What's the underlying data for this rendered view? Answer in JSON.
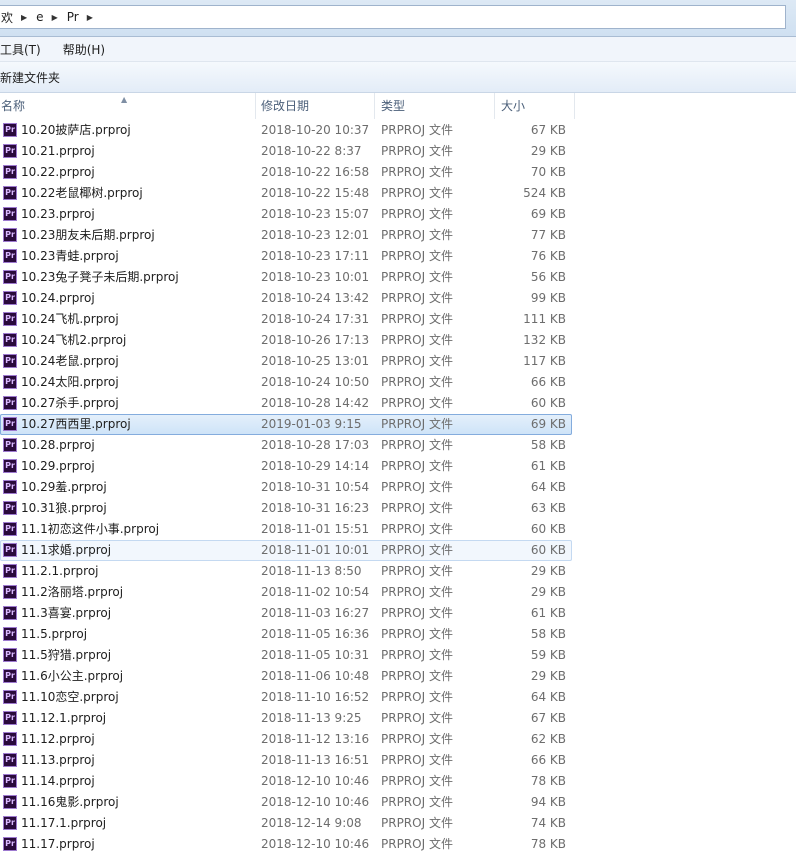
{
  "address": {
    "crumbs": [
      "欢",
      "e",
      "Pr"
    ]
  },
  "menu": {
    "items": [
      "工具(T)",
      "帮助(H)"
    ]
  },
  "toolbar": {
    "new_folder": "新建文件夹"
  },
  "columns": {
    "name": "名称",
    "date": "修改日期",
    "type": "类型",
    "size": "大小"
  },
  "icon": {
    "label": "Pr",
    "name": "premiere-project-icon"
  },
  "files": [
    {
      "name": "10.20披萨店.prproj",
      "date": "2018-10-20 10:37",
      "type": "PRPROJ 文件",
      "size": "67 KB"
    },
    {
      "name": "10.21.prproj",
      "date": "2018-10-22 8:37",
      "type": "PRPROJ 文件",
      "size": "29 KB"
    },
    {
      "name": "10.22.prproj",
      "date": "2018-10-22 16:58",
      "type": "PRPROJ 文件",
      "size": "70 KB"
    },
    {
      "name": "10.22老鼠椰树.prproj",
      "date": "2018-10-22 15:48",
      "type": "PRPROJ 文件",
      "size": "524 KB"
    },
    {
      "name": "10.23.prproj",
      "date": "2018-10-23 15:07",
      "type": "PRPROJ 文件",
      "size": "69 KB"
    },
    {
      "name": "10.23朋友未后期.prproj",
      "date": "2018-10-23 12:01",
      "type": "PRPROJ 文件",
      "size": "77 KB"
    },
    {
      "name": "10.23青蛙.prproj",
      "date": "2018-10-23 17:11",
      "type": "PRPROJ 文件",
      "size": "76 KB"
    },
    {
      "name": "10.23兔子凳子未后期.prproj",
      "date": "2018-10-23 10:01",
      "type": "PRPROJ 文件",
      "size": "56 KB"
    },
    {
      "name": "10.24.prproj",
      "date": "2018-10-24 13:42",
      "type": "PRPROJ 文件",
      "size": "99 KB"
    },
    {
      "name": "10.24飞机.prproj",
      "date": "2018-10-24 17:31",
      "type": "PRPROJ 文件",
      "size": "111 KB"
    },
    {
      "name": "10.24飞机2.prproj",
      "date": "2018-10-26 17:13",
      "type": "PRPROJ 文件",
      "size": "132 KB"
    },
    {
      "name": "10.24老鼠.prproj",
      "date": "2018-10-25 13:01",
      "type": "PRPROJ 文件",
      "size": "117 KB"
    },
    {
      "name": "10.24太阳.prproj",
      "date": "2018-10-24 10:50",
      "type": "PRPROJ 文件",
      "size": "66 KB"
    },
    {
      "name": "10.27杀手.prproj",
      "date": "2018-10-28 14:42",
      "type": "PRPROJ 文件",
      "size": "60 KB"
    },
    {
      "name": "10.27西西里.prproj",
      "date": "2019-01-03 9:15",
      "type": "PRPROJ 文件",
      "size": "69 KB",
      "state": "selected"
    },
    {
      "name": "10.28.prproj",
      "date": "2018-10-28 17:03",
      "type": "PRPROJ 文件",
      "size": "58 KB"
    },
    {
      "name": "10.29.prproj",
      "date": "2018-10-29 14:14",
      "type": "PRPROJ 文件",
      "size": "61 KB"
    },
    {
      "name": "10.29羞.prproj",
      "date": "2018-10-31 10:54",
      "type": "PRPROJ 文件",
      "size": "64 KB"
    },
    {
      "name": "10.31狼.prproj",
      "date": "2018-10-31 16:23",
      "type": "PRPROJ 文件",
      "size": "63 KB"
    },
    {
      "name": "11.1初恋这件小事.prproj",
      "date": "2018-11-01 15:51",
      "type": "PRPROJ 文件",
      "size": "60 KB"
    },
    {
      "name": "11.1求婚.prproj",
      "date": "2018-11-01 10:01",
      "type": "PRPROJ 文件",
      "size": "60 KB",
      "state": "hover"
    },
    {
      "name": "11.2.1.prproj",
      "date": "2018-11-13 8:50",
      "type": "PRPROJ 文件",
      "size": "29 KB"
    },
    {
      "name": "11.2洛丽塔.prproj",
      "date": "2018-11-02 10:54",
      "type": "PRPROJ 文件",
      "size": "29 KB"
    },
    {
      "name": "11.3喜宴.prproj",
      "date": "2018-11-03 16:27",
      "type": "PRPROJ 文件",
      "size": "61 KB"
    },
    {
      "name": "11.5.prproj",
      "date": "2018-11-05 16:36",
      "type": "PRPROJ 文件",
      "size": "58 KB"
    },
    {
      "name": "11.5狩猎.prproj",
      "date": "2018-11-05 10:31",
      "type": "PRPROJ 文件",
      "size": "59 KB"
    },
    {
      "name": "11.6小公主.prproj",
      "date": "2018-11-06 10:48",
      "type": "PRPROJ 文件",
      "size": "29 KB"
    },
    {
      "name": "11.10恋空.prproj",
      "date": "2018-11-10 16:52",
      "type": "PRPROJ 文件",
      "size": "64 KB"
    },
    {
      "name": "11.12.1.prproj",
      "date": "2018-11-13 9:25",
      "type": "PRPROJ 文件",
      "size": "67 KB"
    },
    {
      "name": "11.12.prproj",
      "date": "2018-11-12 13:16",
      "type": "PRPROJ 文件",
      "size": "62 KB"
    },
    {
      "name": "11.13.prproj",
      "date": "2018-11-13 16:51",
      "type": "PRPROJ 文件",
      "size": "66 KB"
    },
    {
      "name": "11.14.prproj",
      "date": "2018-12-10 10:46",
      "type": "PRPROJ 文件",
      "size": "78 KB"
    },
    {
      "name": "11.16鬼影.prproj",
      "date": "2018-12-10 10:46",
      "type": "PRPROJ 文件",
      "size": "94 KB"
    },
    {
      "name": "11.17.1.prproj",
      "date": "2018-12-14 9:08",
      "type": "PRPROJ 文件",
      "size": "74 KB"
    },
    {
      "name": "11.17.prproj",
      "date": "2018-12-10 10:46",
      "type": "PRPROJ 文件",
      "size": "78 KB"
    }
  ]
}
